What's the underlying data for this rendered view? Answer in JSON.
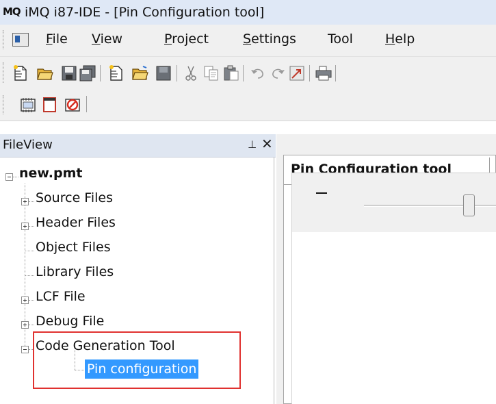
{
  "window": {
    "logo_text": "MQ",
    "title": "iMQ i87-IDE - [Pin Configuration tool]"
  },
  "menu": {
    "items": [
      {
        "label": "File",
        "mnemonic": "F"
      },
      {
        "label": "View",
        "mnemonic": "V"
      },
      {
        "label": "Project",
        "mnemonic": "P"
      },
      {
        "label": "Settings",
        "mnemonic": "S"
      },
      {
        "label": "Tool",
        "mnemonic": ""
      },
      {
        "label": "Help",
        "mnemonic": "H"
      }
    ]
  },
  "toolbar1": {
    "buttons": [
      "new-file-icon",
      "open-folder-icon",
      "save-icon",
      "save-all-icon",
      "new-project-icon",
      "open-project-icon",
      "close-project-icon",
      "cut-icon",
      "copy-icon",
      "paste-icon",
      "undo-icon",
      "redo-icon",
      "find-icon",
      "print-icon"
    ]
  },
  "toolbar2": {
    "buttons": [
      "pin-grid-icon",
      "window-icon",
      "no-debug-icon"
    ]
  },
  "fileview": {
    "title": "FileView",
    "pin_glyph": "⊥",
    "close_glyph": "✕",
    "root": "new.pmt",
    "items": [
      {
        "label": "Source Files",
        "expandable": true
      },
      {
        "label": "Header Files",
        "expandable": true
      },
      {
        "label": "Object Files",
        "expandable": false
      },
      {
        "label": "Library Files",
        "expandable": false
      },
      {
        "label": "LCF File",
        "expandable": true
      },
      {
        "label": "Debug File",
        "expandable": true
      },
      {
        "label": "Code Generation Tool",
        "expandable": true,
        "expanded": true
      }
    ],
    "selected_child": "Pin configuration"
  },
  "editor": {
    "tab_label": "Pin Configuration tool"
  },
  "colors": {
    "selection": "#3399ff",
    "highlight_border": "#e0312f",
    "title_bar": "#dfe8f6",
    "panel_header": "#dfe6f1"
  }
}
